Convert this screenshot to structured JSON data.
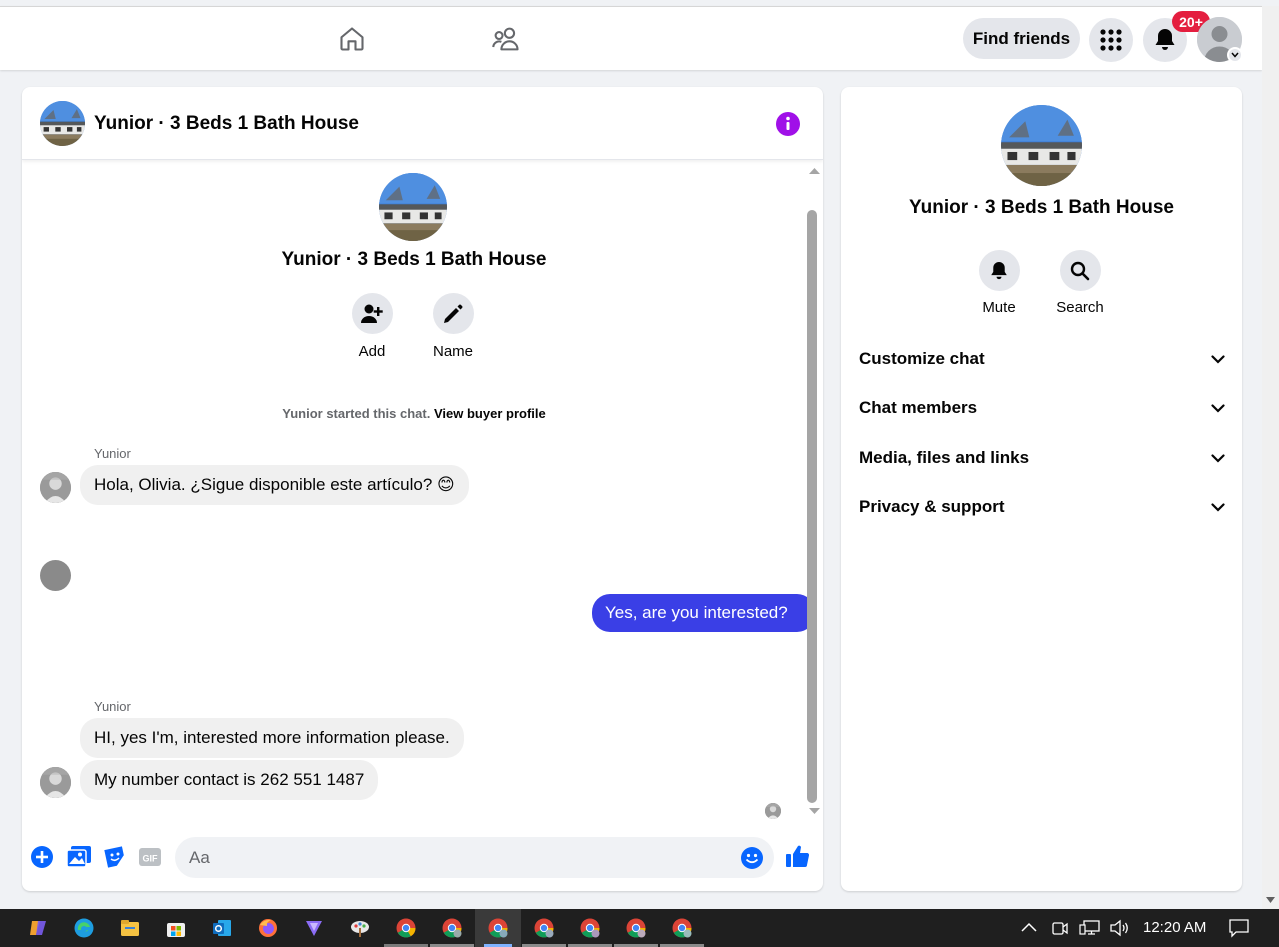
{
  "topbar": {
    "find_friends_label": "Find friends",
    "notification_count": "20+"
  },
  "chat": {
    "title": "Yunior · 3 Beds 1 Bath House",
    "actions": [
      {
        "label": "Add",
        "icon": "add-person-icon"
      },
      {
        "label": "Name",
        "icon": "pencil-icon"
      }
    ],
    "started_text": "Yunior started this chat.",
    "view_profile_link": "View buyer profile",
    "messages": [
      {
        "sender": "Yunior",
        "text": "Hola, Olivia. ¿Sigue disponible este artículo? 😊",
        "direction": "incoming"
      },
      {
        "text": "Yes, are you interested?",
        "direction": "outgoing"
      },
      {
        "sender": "Yunior",
        "text": "HI, yes I'm, interested  more information please.",
        "direction": "incoming"
      },
      {
        "text": "My number contact is 262 551 1487",
        "direction": "incoming"
      }
    ],
    "composer": {
      "placeholder": "Aa"
    }
  },
  "details": {
    "title": "Yunior · 3 Beds 1 Bath House",
    "actions": [
      {
        "label": "Mute",
        "icon": "bell-icon"
      },
      {
        "label": "Search",
        "icon": "search-icon"
      }
    ],
    "sections": [
      {
        "label": "Customize chat"
      },
      {
        "label": "Chat members"
      },
      {
        "label": "Media, files and links"
      },
      {
        "label": "Privacy & support"
      }
    ]
  },
  "taskbar": {
    "time": "12:20 AM"
  },
  "colors": {
    "accent_blue": "#0866ff",
    "outgoing_bubble": "#3a3fe6",
    "info_purple": "#a010e8",
    "badge_red": "#e41e3f"
  }
}
